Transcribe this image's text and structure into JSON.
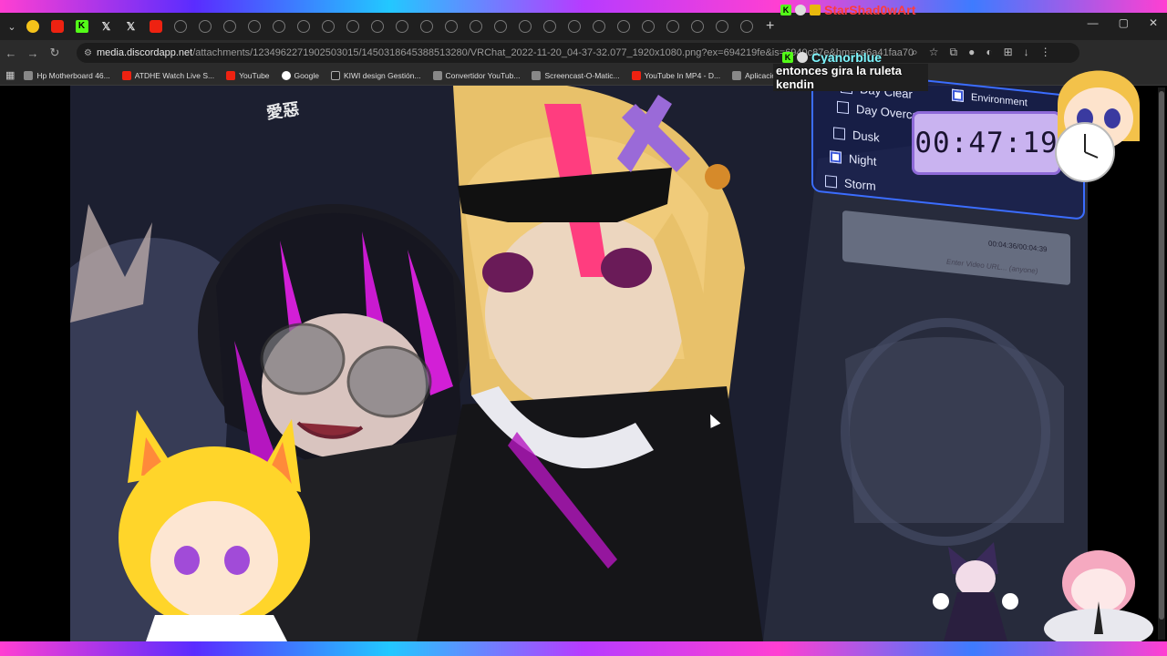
{
  "browser": {
    "tabs_count": 31,
    "new_tab_label": "+",
    "window_controls": [
      "—",
      "▢",
      "✕"
    ]
  },
  "address_bar": {
    "host": "media.discordapp.net",
    "path": "/attachments/1234962271902503015/1450318645388513280/VRChat_2022-11-20_04-37-32.077_1920x1080.png?ex=694219fe&is=6940c87e&hm=ce6a41faa70"
  },
  "bookmarks": [
    {
      "label": "Hp Motherboard 46...",
      "icon": "generic"
    },
    {
      "label": "ATDHE Watch Live S...",
      "icon": "generic"
    },
    {
      "label": "YouTube",
      "icon": "youtube"
    },
    {
      "label": "Google",
      "icon": "google"
    },
    {
      "label": "KIWI design Gestión...",
      "icon": "black"
    },
    {
      "label": "Convertidor YouTub...",
      "icon": "generic"
    },
    {
      "label": "Screencast-O-Matic...",
      "icon": "generic"
    },
    {
      "label": "YouTube In MP4 - D...",
      "icon": "generic"
    },
    {
      "label": "Aplicaciones",
      "icon": "apps"
    }
  ],
  "chat": {
    "messages": [
      {
        "user": "StarShad0wArt",
        "color": "#ff3b3b",
        "text": ""
      },
      {
        "user": "Cyanorblue",
        "color": "#7df7ff",
        "text": "entonces gira la ruleta kendin"
      }
    ]
  },
  "timer": {
    "value": "00:47:19"
  },
  "vr_menu": {
    "options": [
      {
        "label": "Day Clear",
        "checked": false
      },
      {
        "label": "Day Overcast",
        "checked": false
      },
      {
        "label": "Dusk",
        "checked": false
      },
      {
        "label": "Night",
        "checked": true
      },
      {
        "label": "Storm",
        "checked": false
      }
    ],
    "env_label": "Environment"
  },
  "video_player": {
    "time": "00:04:36/00:04:39",
    "url_placeholder": "Enter Video URL... (anyone)"
  },
  "overlay_text": "愛惡"
}
